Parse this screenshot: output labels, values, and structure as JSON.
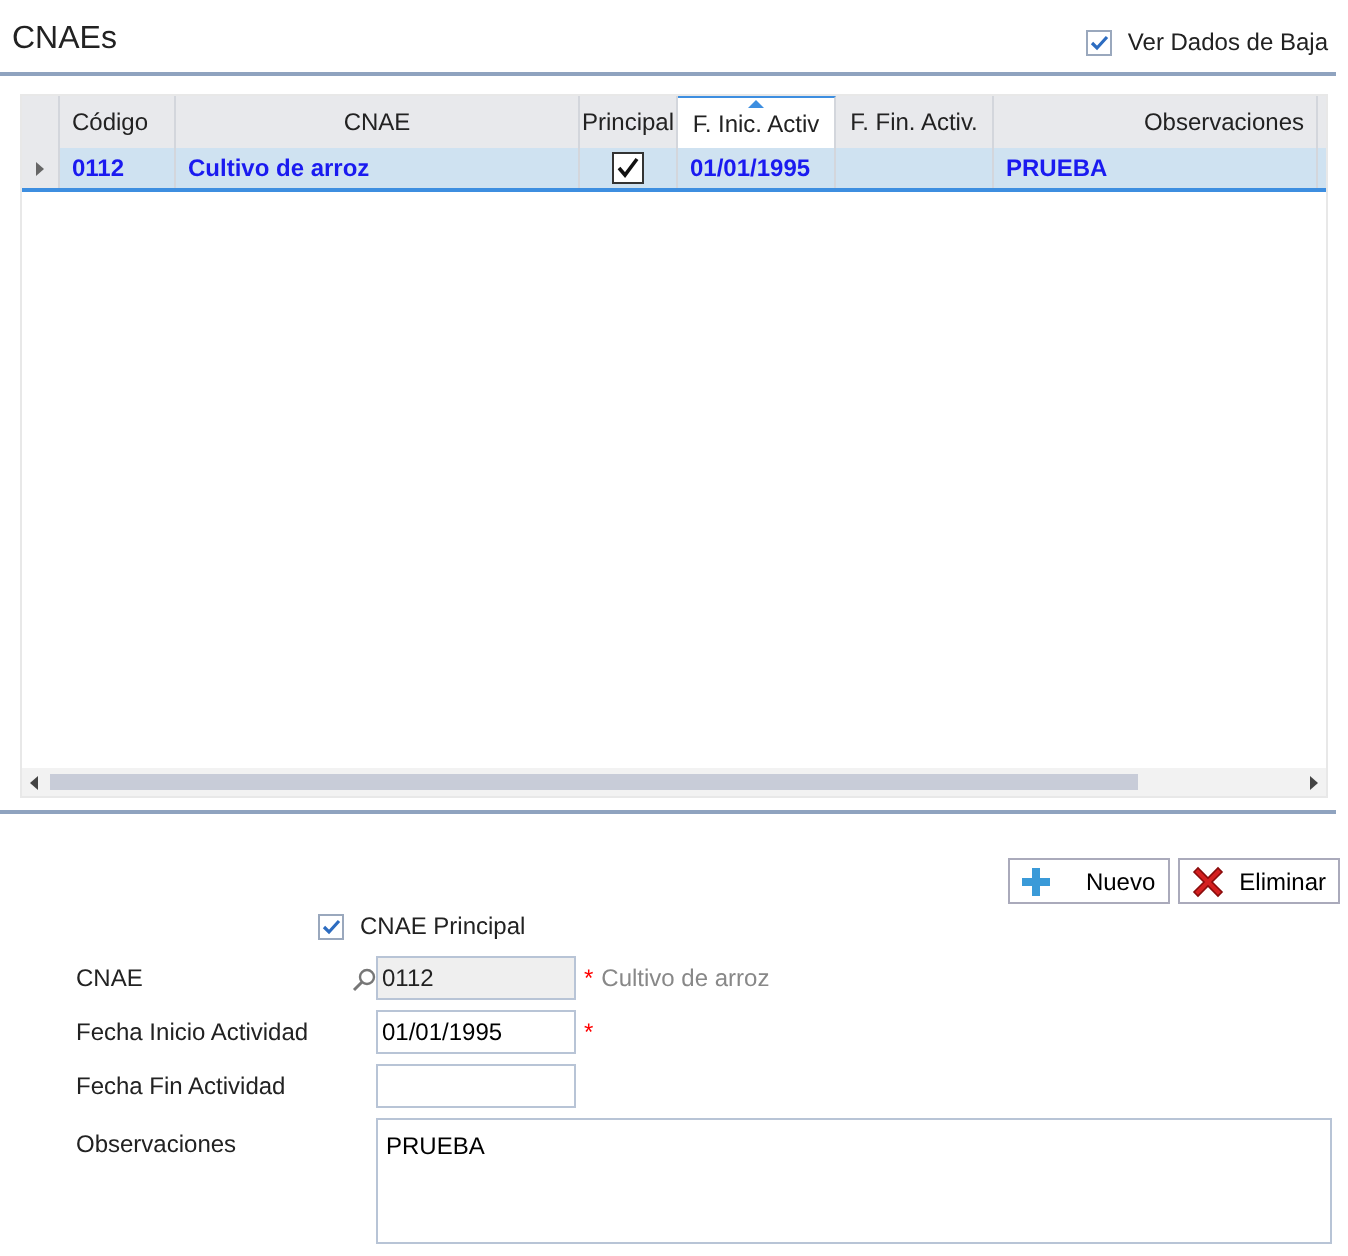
{
  "title": "CNAEs",
  "show_deleted": {
    "label": "Ver Dados de Baja",
    "checked": true
  },
  "table": {
    "columns": [
      {
        "label": "Código",
        "sorted": false
      },
      {
        "label": "CNAE",
        "sorted": false
      },
      {
        "label": "Principal",
        "sorted": false
      },
      {
        "label": "F. Inic. Activ",
        "sorted": true
      },
      {
        "label": "F. Fin. Activ.",
        "sorted": false
      },
      {
        "label": "Observaciones",
        "sorted": false
      }
    ],
    "rows": [
      {
        "selected": true,
        "codigo": "0112",
        "cnae": "Cultivo de arroz",
        "principal": true,
        "fecha_inicio": "01/01/1995",
        "observaciones": "PRUEBA"
      }
    ]
  },
  "buttons": [
    {
      "label": "Nuevo",
      "kind": "add"
    },
    {
      "label": "Eliminar",
      "kind": "delete"
    }
  ],
  "form": {
    "principal": {
      "label": "CNAE Principal",
      "checked": true
    },
    "fields": [
      {
        "label": "CNAE",
        "kind": "lookup",
        "value": "0112",
        "disabled": true,
        "required_mark": "*",
        "description": "Cultivo de arroz"
      },
      {
        "label": "Fecha Inicio Actividad",
        "kind": "text",
        "value": "01/01/1995",
        "disabled": false,
        "required_mark": "*"
      },
      {
        "label": "Fecha Fin Actividad",
        "kind": "text",
        "disabled": false
      },
      {
        "label": "Observaciones",
        "kind": "textarea",
        "value": "PRUEBA",
        "disabled": false
      }
    ]
  }
}
